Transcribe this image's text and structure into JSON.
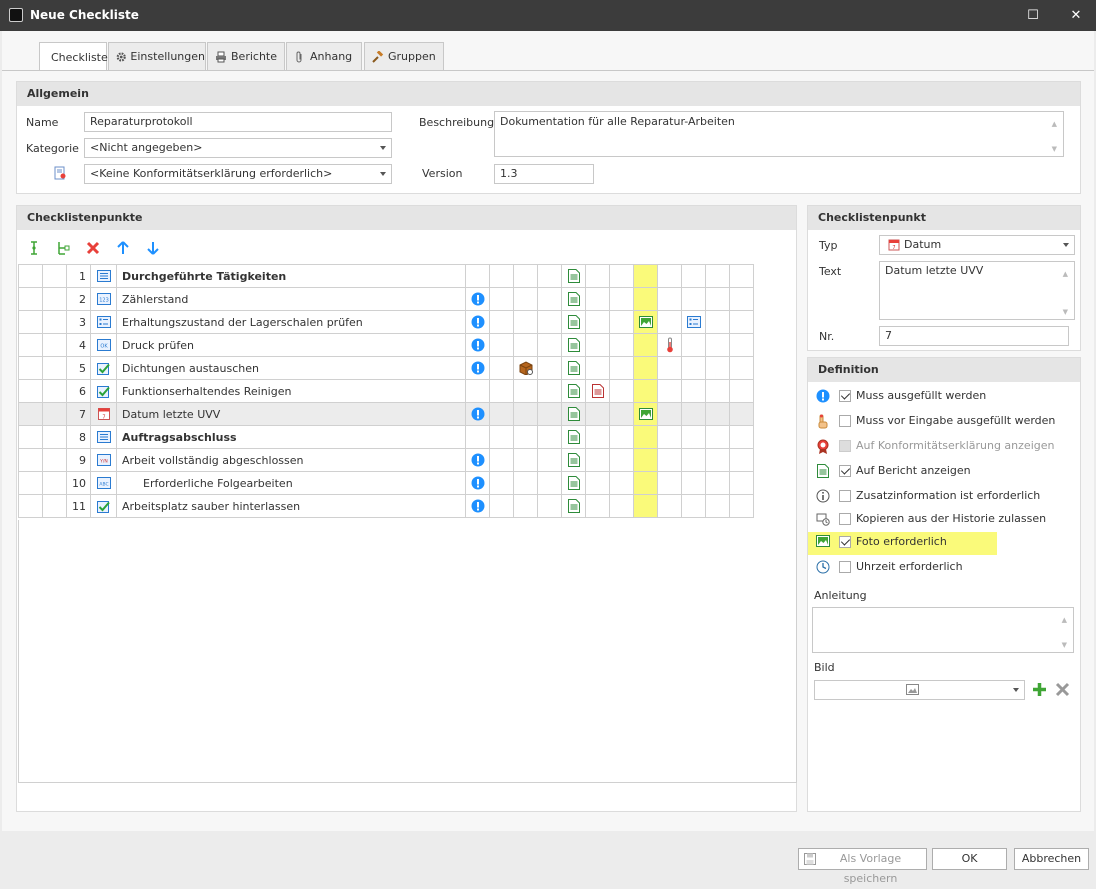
{
  "window": {
    "title": "Neue Checkliste"
  },
  "tabs": [
    {
      "label": "Checkliste"
    },
    {
      "label": "Einstellungen"
    },
    {
      "label": "Berichte"
    },
    {
      "label": "Anhang"
    },
    {
      "label": "Gruppen"
    }
  ],
  "general": {
    "heading": "Allgemein",
    "name_label": "Name",
    "name_value": "Reparaturprotokoll",
    "category_label": "Kategorie",
    "category_value": "<Nicht angegeben>",
    "conformity_value": "<Keine Konformitätserklärung erforderlich>",
    "description_label": "Beschreibung",
    "description_value": "Dokumentation für alle Reparatur-Arbeiten",
    "version_label": "Version",
    "version_value": "1.3"
  },
  "items_panel": {
    "heading": "Checklistenpunkte",
    "rows": [
      {
        "nr": "1",
        "text": "Durchgeführte Tätigkeiten",
        "bold": true,
        "type_icon": "list-icon",
        "required": false,
        "report": true
      },
      {
        "nr": "2",
        "text": "Zählerstand",
        "bold": false,
        "type_icon": "number-icon",
        "required": true,
        "report": true
      },
      {
        "nr": "3",
        "text": "Erhaltungszustand der Lagerschalen prüfen",
        "bold": false,
        "type_icon": "selection-list-icon",
        "required": true,
        "report": true,
        "photo": true,
        "extra_list": true
      },
      {
        "nr": "4",
        "text": "Druck prüfen",
        "bold": false,
        "type_icon": "ok-icon",
        "required": true,
        "report": true,
        "thermometer": true
      },
      {
        "nr": "5",
        "text": "Dichtungen austauschen",
        "bold": false,
        "type_icon": "checkbox-icon",
        "required": true,
        "report": true,
        "history": true
      },
      {
        "nr": "6",
        "text": "Funktionserhaltendes Reinigen",
        "bold": false,
        "type_icon": "checkbox-icon",
        "required": false,
        "report": true,
        "report2": true
      },
      {
        "nr": "7",
        "text": "Datum letzte UVV",
        "bold": false,
        "type_icon": "date-icon",
        "required": true,
        "report": true,
        "photo": true,
        "selected": true
      },
      {
        "nr": "8",
        "text": "Auftragsabschluss",
        "bold": true,
        "type_icon": "list-icon",
        "required": false,
        "report": true
      },
      {
        "nr": "9",
        "text": "Arbeit vollständig abgeschlossen",
        "bold": false,
        "type_icon": "yes-no-icon",
        "required": true,
        "report": true
      },
      {
        "nr": "10",
        "text": "Erforderliche Folgearbeiten",
        "bold": false,
        "indent": true,
        "type_icon": "text-icon",
        "required": true,
        "report": true
      },
      {
        "nr": "11",
        "text": "Arbeitsplatz sauber hinterlassen",
        "bold": false,
        "type_icon": "checkbox-icon",
        "required": true,
        "report": true
      }
    ]
  },
  "item_panel": {
    "heading": "Checklistenpunkt",
    "type_label": "Typ",
    "type_value": "Datum",
    "text_label": "Text",
    "text_value": "Datum letzte UVV",
    "nr_label": "Nr.",
    "nr_value": "7"
  },
  "definition": {
    "heading": "Definition",
    "options": [
      {
        "label": "Muss ausgefüllt werden",
        "checked": true,
        "disabled": false,
        "icon": "required-icon"
      },
      {
        "label": "Muss vor Eingabe ausgefüllt werden",
        "checked": false,
        "disabled": false,
        "icon": "hand-icon"
      },
      {
        "label": "Auf Konformitätserklärung anzeigen",
        "checked": false,
        "disabled": true,
        "icon": "award-icon"
      },
      {
        "label": "Auf Bericht anzeigen",
        "checked": true,
        "disabled": false,
        "icon": "report-icon"
      },
      {
        "label": "Zusatzinformation ist erforderlich",
        "checked": false,
        "disabled": false,
        "icon": "info-icon"
      },
      {
        "label": "Kopieren aus der Historie zulassen",
        "checked": false,
        "disabled": false,
        "icon": "history-icon"
      },
      {
        "label": "Foto erforderlich",
        "checked": true,
        "disabled": false,
        "icon": "photo-icon",
        "highlight": true
      },
      {
        "label": "Uhrzeit erforderlich",
        "checked": false,
        "disabled": false,
        "icon": "clock-icon"
      }
    ],
    "instruction_label": "Anleitung",
    "image_label": "Bild"
  },
  "buttons": {
    "save_template": "Als Vorlage speichern",
    "ok": "OK",
    "cancel": "Abbrechen"
  },
  "colors": {
    "highlight": "#fafa7a",
    "required_blue": "#1e90ff",
    "delete_red": "#e8403a",
    "green": "#3fa535"
  }
}
